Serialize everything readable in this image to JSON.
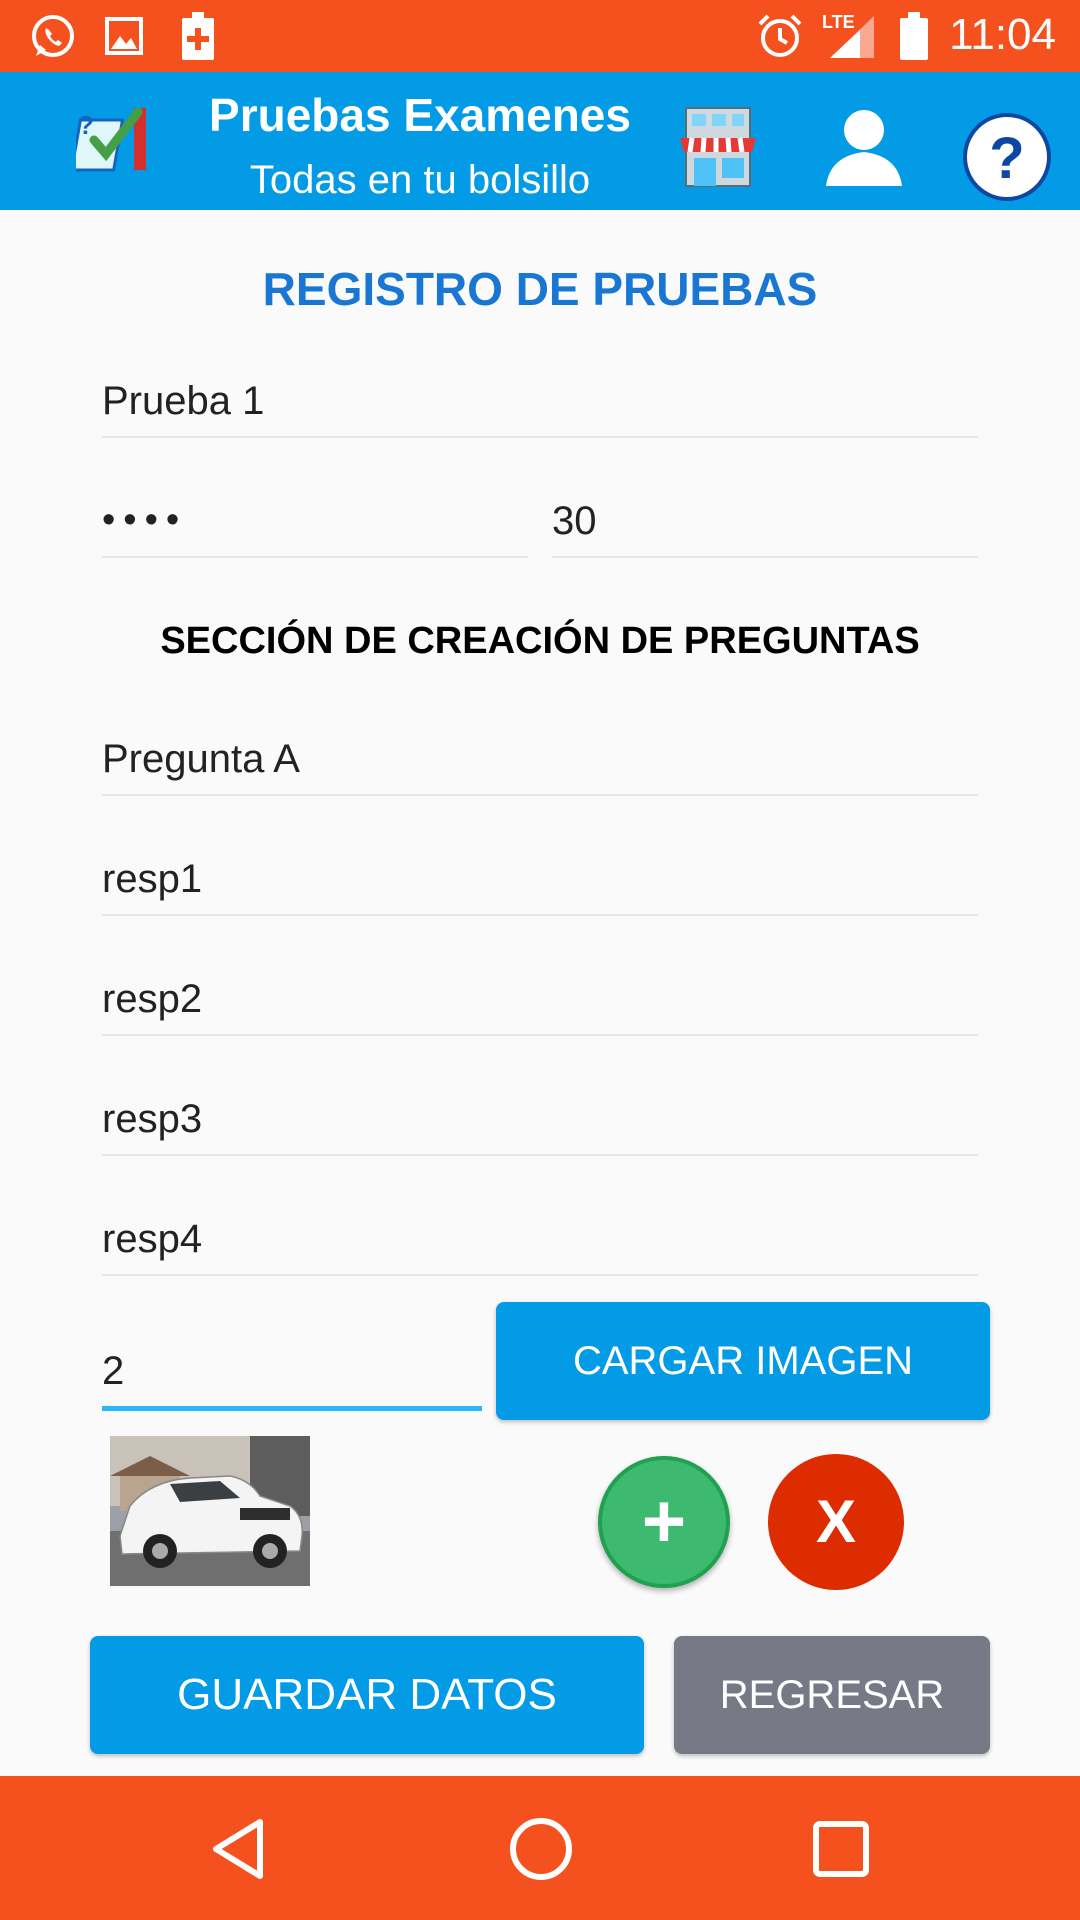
{
  "status_bar": {
    "time": "11:04",
    "network": "LTE",
    "icons": [
      "whatsapp-icon",
      "image-icon",
      "battery-saver-icon",
      "alarm-icon",
      "signal-icon",
      "battery-icon"
    ]
  },
  "app_bar": {
    "title": "Pruebas Examenes",
    "subtitle": "Todas en tu bolsillo",
    "icons": [
      "app-logo-icon",
      "store-icon",
      "profile-icon",
      "help-icon"
    ]
  },
  "form": {
    "page_title": "REGISTRO DE PRUEBAS",
    "test_name": "Prueba 1",
    "password_mask": "••••",
    "duration": "30",
    "section_title": "SECCIÓN DE CREACIÓN DE PREGUNTAS",
    "question": "Pregunta A",
    "answers": [
      "resp1",
      "resp2",
      "resp3",
      "resp4"
    ],
    "correct_answer": "2",
    "load_image_label": "CARGAR IMAGEN",
    "add_symbol": "+",
    "delete_symbol": "X",
    "save_label": "GUARDAR DATOS",
    "back_label": "REGRESAR"
  },
  "colors": {
    "status_bar": "#f4511e",
    "app_bar": "#039be5",
    "title": "#1976d2",
    "button_blue": "#039be5",
    "button_gray": "#777a86",
    "fab_green": "#3dba6f",
    "fab_red": "#dd2c00",
    "active_underline": "#29b6f6"
  },
  "nav_bar": {
    "icons": [
      "back-icon",
      "home-icon",
      "recents-icon"
    ]
  }
}
